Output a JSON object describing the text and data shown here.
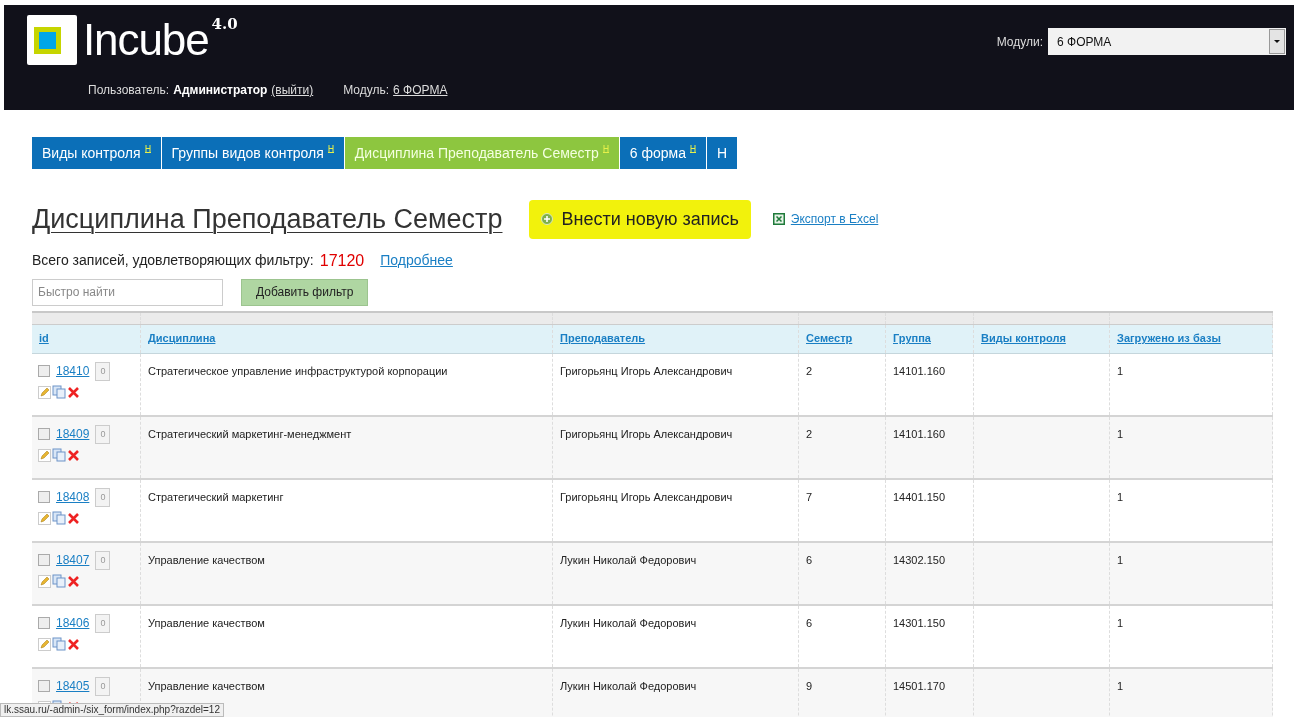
{
  "header": {
    "logo_text": "Incube",
    "version": "4.0",
    "user_label": "Пользователь:",
    "user_name": "Администратор",
    "logout_link": "(выйти)",
    "module_label": "Модуль:",
    "module_link": "6 ФОРМА",
    "modules_label": "Модули:",
    "modules_value": "6 ФОРМА"
  },
  "tabs": [
    {
      "label": "Виды контроля",
      "selected": false,
      "has_icon": true
    },
    {
      "label": "Группы видов контроля",
      "selected": false,
      "has_icon": true
    },
    {
      "label": "Дисциплина Преподаватель Семестр",
      "selected": true,
      "has_icon": true
    },
    {
      "label": "6 форма",
      "selected": false,
      "has_icon": true
    },
    {
      "label": "Н",
      "selected": false,
      "has_icon": false
    }
  ],
  "page": {
    "title": "Дисциплина Преподаватель Семестр",
    "add_button": "Внести новую запись",
    "export_link": "Экспорт в Excel",
    "total_label": "Всего записей, удовлетворяющих фильтру:",
    "total_count": "17120",
    "details_link": "Подробнее",
    "search_placeholder": "Быстро найти",
    "filter_button": "Добавить фильтр"
  },
  "table": {
    "columns": [
      "id",
      "Дисциплина",
      "Преподаватель",
      "Семестр",
      "Группа",
      "Виды контроля",
      "Загружено из базы"
    ],
    "rows": [
      {
        "id": "18410",
        "count": "0",
        "checked": false,
        "discipline": "Стратегическое управление инфраструктурой корпорации",
        "teacher": "Григорьянц Игорь Александрович",
        "semester": "2",
        "group": "14101.160",
        "control": "",
        "loaded": "1"
      },
      {
        "id": "18409",
        "count": "0",
        "checked": false,
        "discipline": "Стратегический маркетинг-менеджмент",
        "teacher": "Григорьянц Игорь Александрович",
        "semester": "2",
        "group": "14101.160",
        "control": "",
        "loaded": "1"
      },
      {
        "id": "18408",
        "count": "0",
        "checked": false,
        "discipline": "Стратегический маркетинг",
        "teacher": "Григорьянц Игорь Александрович",
        "semester": "7",
        "group": "14401.150",
        "control": "",
        "loaded": "1"
      },
      {
        "id": "18407",
        "count": "0",
        "checked": false,
        "discipline": "Управление качеством",
        "teacher": "Лукин Николай Федорович",
        "semester": "6",
        "group": "14302.150",
        "control": "",
        "loaded": "1"
      },
      {
        "id": "18406",
        "count": "0",
        "checked": false,
        "discipline": "Управление качеством",
        "teacher": "Лукин Николай Федорович",
        "semester": "6",
        "group": "14301.150",
        "control": "",
        "loaded": "1"
      },
      {
        "id": "18405",
        "count": "0",
        "checked": false,
        "discipline": "Управление качеством",
        "teacher": "Лукин Николай Федорович",
        "semester": "9",
        "group": "14501.170",
        "control": "",
        "loaded": "1"
      }
    ]
  },
  "status_bar": {
    "url": "lk.ssau.ru/-admin-/six_form/index.php?razdel=12"
  }
}
